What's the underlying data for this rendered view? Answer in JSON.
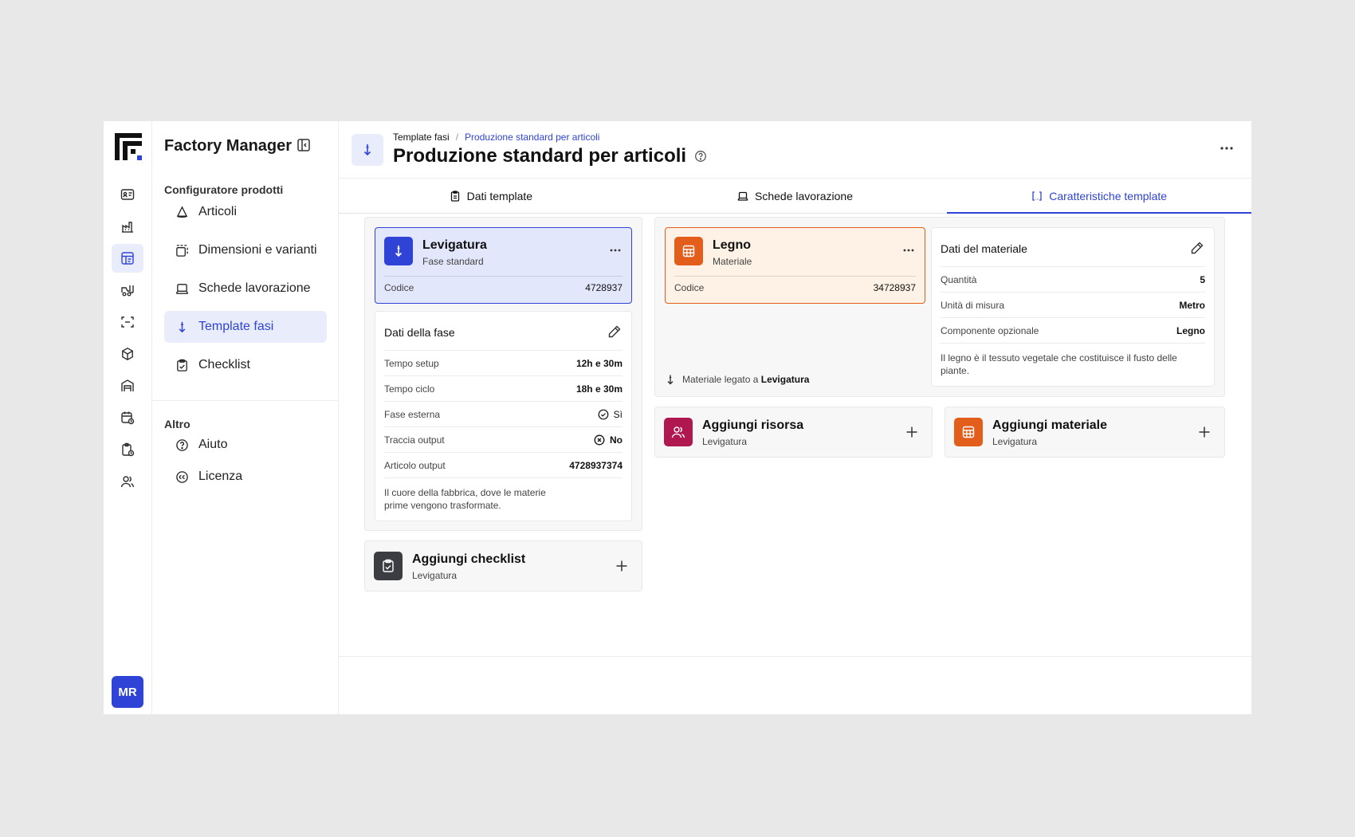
{
  "app": {
    "title": "Factory Manager",
    "avatar": "MR"
  },
  "rail": {
    "icons": [
      "id-card-icon",
      "factory-icon",
      "template-icon",
      "forklift-icon",
      "scan-icon",
      "box-icon",
      "warehouse-icon",
      "calendar-icon",
      "clipboard-clock-icon",
      "users-icon"
    ],
    "active_index": 2
  },
  "sidenav": {
    "section1": "Configuratore prodotti",
    "items": [
      {
        "label": "Articoli",
        "icon": "cone-icon"
      },
      {
        "label": "Dimensioni e varianti",
        "icon": "variants-icon"
      },
      {
        "label": "Schede lavorazione",
        "icon": "laptop-icon"
      },
      {
        "label": "Template fasi",
        "icon": "arrow-down-icon"
      },
      {
        "label": "Checklist",
        "icon": "checklist-icon"
      }
    ],
    "active_index": 3,
    "section2": "Altro",
    "items2": [
      {
        "label": "Aiuto",
        "icon": "help-circle-icon"
      },
      {
        "label": "Licenza",
        "icon": "cc-license-icon"
      }
    ]
  },
  "header": {
    "breadcrumb": [
      "Template fasi",
      "Produzione standard per articoli"
    ],
    "title": "Produzione standard per articoli"
  },
  "tabs": [
    {
      "label": "Dati template",
      "icon": "clipboard-icon"
    },
    {
      "label": "Schede lavorazione",
      "icon": "laptop-icon"
    },
    {
      "label": "Caratteristiche template",
      "icon": "bracket-icon"
    }
  ],
  "active_tab": 2,
  "phase": {
    "title": "Levigatura",
    "subtitle": "Fase standard",
    "code_label": "Codice",
    "code": "4728937",
    "color": "#2f44d6",
    "details_title": "Dati della fase",
    "rows": [
      {
        "label": "Tempo setup",
        "value": "12h e 30m"
      },
      {
        "label": "Tempo ciclo",
        "value": "18h e 30m"
      },
      {
        "label": "Fase esterna",
        "value": "Sì"
      },
      {
        "label": "Traccia output",
        "value": "No"
      },
      {
        "label": "Articolo output",
        "value": "4728937374"
      }
    ],
    "description": "Il cuore della fabbrica, dove le materie prime vengono trasformate."
  },
  "add_checklist": {
    "title": "Aggiungi checklist",
    "subtitle": "Levigatura",
    "color": "#3b3d42"
  },
  "material": {
    "title": "Legno",
    "subtitle": "Materiale",
    "code_label": "Codice",
    "code": "34728937",
    "color": "#e35d1b",
    "linked_prefix": "Materiale legato a",
    "linked_to": "Levigatura",
    "details_title": "Dati del materiale",
    "rows": [
      {
        "label": "Quantità",
        "value": "5"
      },
      {
        "label": "Unità di misura",
        "value": "Metro"
      },
      {
        "label": "Componente opzionale",
        "value": "Legno"
      }
    ],
    "description": "Il legno è il tessuto vegetale che costituisce il fusto delle piante."
  },
  "add_resource": {
    "title": "Aggiungi risorsa",
    "subtitle": "Levigatura",
    "color": "#b0174f"
  },
  "add_material": {
    "title": "Aggiungi materiale",
    "subtitle": "Levigatura",
    "color": "#e35d1b"
  }
}
